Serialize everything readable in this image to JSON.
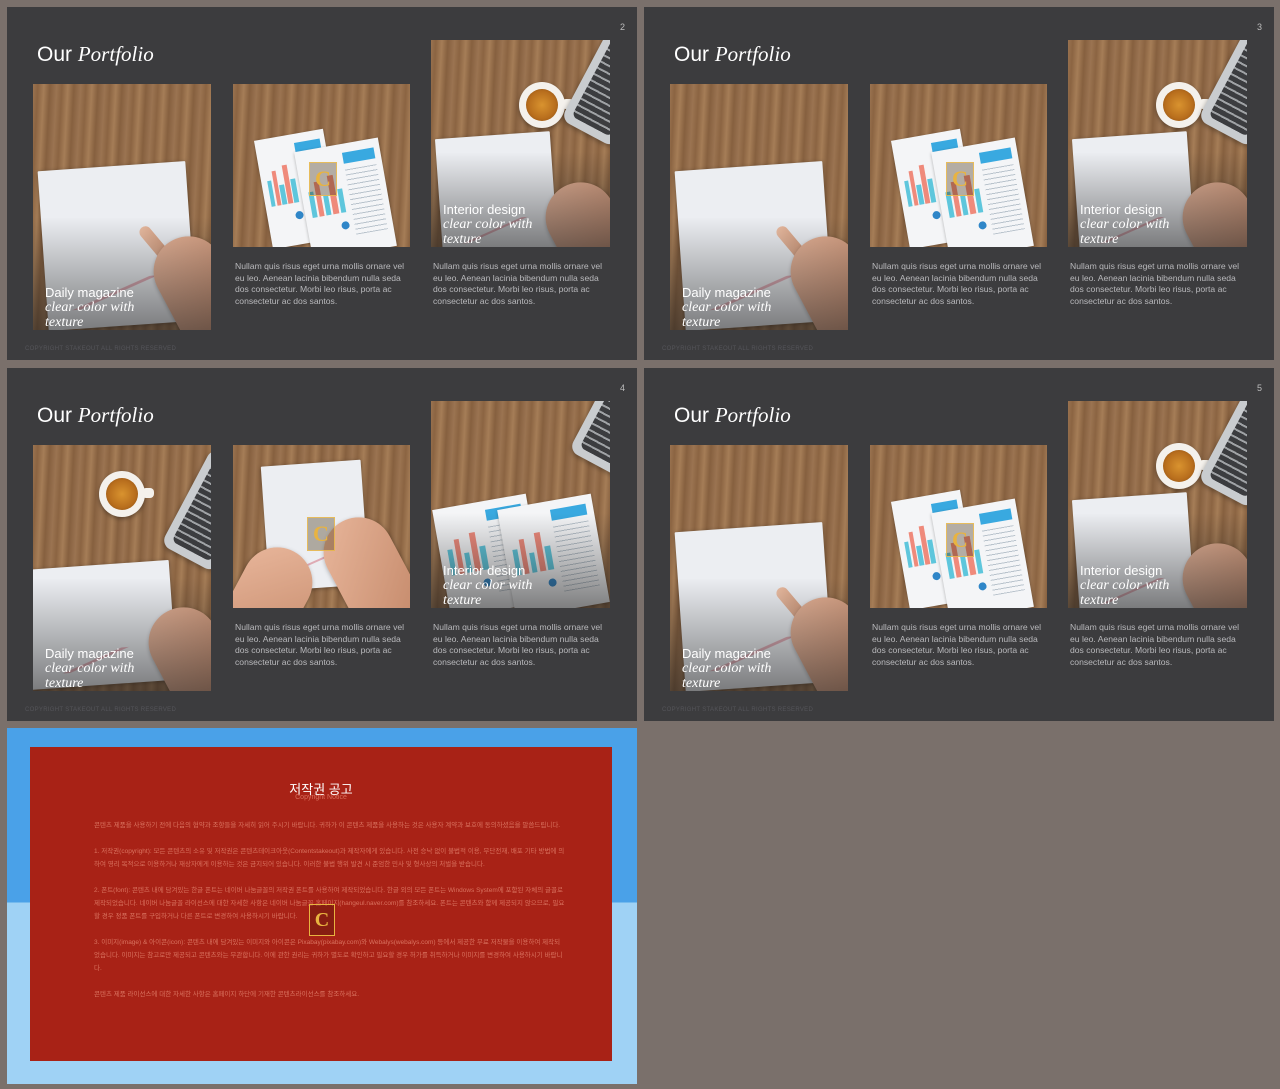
{
  "slides": [
    {
      "number": "2",
      "title_plain": "Our",
      "title_italic": "Portfolio",
      "footer_note": "COPYRIGHT STAKEOUT ALL RIGHTS RESERVED",
      "cards": [
        {
          "caption_line1": "Daily magazine",
          "caption_line2": "clear color with",
          "caption_line3": "texture"
        },
        {
          "description": "Nullam quis risus eget urna mollis ornare vel eu leo. Aenean lacinia bibendum nulla seda dos consectetur. Morbi leo risus, porta ac consectetur ac dos santos."
        },
        {
          "caption_line1": "Interior design",
          "caption_line2": "clear color with",
          "caption_line3": "texture",
          "description": "Nullam quis risus eget urna mollis ornare vel eu leo. Aenean lacinia bibendum nulla seda dos consectetur. Morbi leo risus, porta ac consectetur ac dos santos."
        }
      ]
    },
    {
      "number": "3",
      "title_plain": "Our",
      "title_italic": "Portfolio",
      "footer_note": "COPYRIGHT STAKEOUT ALL RIGHTS RESERVED",
      "cards": [
        {
          "caption_line1": "Daily magazine",
          "caption_line2": "clear color with",
          "caption_line3": "texture"
        },
        {
          "description": "Nullam quis risus eget urna mollis ornare vel eu leo. Aenean lacinia bibendum nulla seda dos consectetur. Morbi leo risus, porta ac consectetur ac dos santos."
        },
        {
          "caption_line1": "Interior design",
          "caption_line2": "clear color with",
          "caption_line3": "texture",
          "description": "Nullam quis risus eget urna mollis ornare vel eu leo. Aenean lacinia bibendum nulla seda dos consectetur. Morbi leo risus, porta ac consectetur ac dos santos."
        }
      ]
    },
    {
      "number": "4",
      "title_plain": "Our",
      "title_italic": "Portfolio",
      "footer_note": "COPYRIGHT STAKEOUT ALL RIGHTS RESERVED",
      "cards": [
        {
          "caption_line1": "Daily magazine",
          "caption_line2": "clear color with",
          "caption_line3": "texture"
        },
        {
          "description": "Nullam quis risus eget urna mollis ornare vel eu leo. Aenean lacinia bibendum nulla seda dos consectetur. Morbi leo risus, porta ac consectetur ac dos santos."
        },
        {
          "caption_line1": "Interior design",
          "caption_line2": "clear color with",
          "caption_line3": "texture",
          "description": "Nullam quis risus eget urna mollis ornare vel eu leo. Aenean lacinia bibendum nulla seda dos consectetur. Morbi leo risus, porta ac consectetur ac dos santos."
        }
      ]
    },
    {
      "number": "5",
      "title_plain": "Our",
      "title_italic": "Portfolio",
      "footer_note": "COPYRIGHT STAKEOUT ALL RIGHTS RESERVED",
      "cards": [
        {
          "caption_line1": "Daily magazine",
          "caption_line2": "clear color with",
          "caption_line3": "texture"
        },
        {
          "description": "Nullam quis risus eget urna mollis ornare vel eu leo. Aenean lacinia bibendum nulla seda dos consectetur. Morbi leo risus, porta ac consectetur ac dos santos."
        },
        {
          "caption_line1": "Interior design",
          "caption_line2": "clear color with",
          "caption_line3": "texture",
          "description": "Nullam quis risus eget urna mollis ornare vel eu leo. Aenean lacinia bibendum nulla seda dos consectetur. Morbi leo risus, porta ac consectetur ac dos santos."
        }
      ]
    }
  ],
  "logo_letter": "C",
  "copyright": {
    "title": "저작권 공고",
    "subtitle": "Copyright Notice",
    "paragraphs": [
      "콘텐츠 제품을 사용하기 전에 다음의 협약과 조항들을 자세히 읽어 주시기 바랍니다. 귀하가 이 콘텐츠 제품을 사용하는 것은 사용자 계약과 보호에 동의하셨음을 말씀드립니다.",
      "1. 저작권(copyright): 모든 콘텐츠의 소유 및 저작권은 콘텐츠테이크아웃(Contentstakeout)과 제작자에게 있습니다. 사전 승낙 없이 불법적 이용, 무단전재, 배포 기타 방법에 의하여 영리 목적으로 이용하거나 재상자에게 이용하는 것은 금지되어 있습니다. 이러한 불법 행위 발견 시 준엄한 민사 및 형사상의 처벌을 받습니다.",
      "2. 폰트(font): 콘텐츠 내에 담겨있는 한글 폰트는 네이버 나눔글꼴의 저작권 폰트를 사용하여 제작되었습니다. 한글 외의 모든 폰트는 Windows System에 포함된 자체의 글꼴로 제작되었습니다. 네이버 나눔글꼴 라이선스에 대한 자세한 사항은 네이버 나눔글꼴 홈페이지(hangeul.naver.com)를 참조하세요. 폰트는 콘텐츠와 함께 제공되지 않으므로, 필요할 경우 정품 폰트를 구입하거나 다른 폰트로 변경하여 사용하시기 바랍니다.",
      "3. 이미지(image) & 아이콘(icon): 콘텐츠 내에 담겨있는 이미지와 아이콘은 Pixabay(pixabay.com)와 Webalys(webalys.com) 등에서 제공한 무료 저작물을 이용하여 제작되었습니다. 이미지는 참고로만 제공되고 콘텐츠와는 무관합니다. 이에 관한 권리는 귀하가 별도로 확인하고 필요할 경우 허가를 취득하거나 이미지를 변경하여 사용하시기 바랍니다.",
      "콘텐츠 제품 라이선스에 대한 자세한 사항은 홈페이지 하단에 기재한 콘텐츠라이선스를 참조하세요."
    ]
  },
  "colors": {
    "page_bg": "#7a706b",
    "slide_bg": "#3c3c3e",
    "copyright_panel": "#a82216",
    "copyright_bg_top": "#4aa1e8",
    "copyright_bg_bottom": "#9fd2f5",
    "chart_yellow": "#f6c842",
    "chart_coral": "#ef8a7b",
    "chart_cyan": "#5ec6dc"
  },
  "icons": [
    "coffee-cup-icon",
    "laptop-icon",
    "hand-icon",
    "logo-c-icon"
  ]
}
